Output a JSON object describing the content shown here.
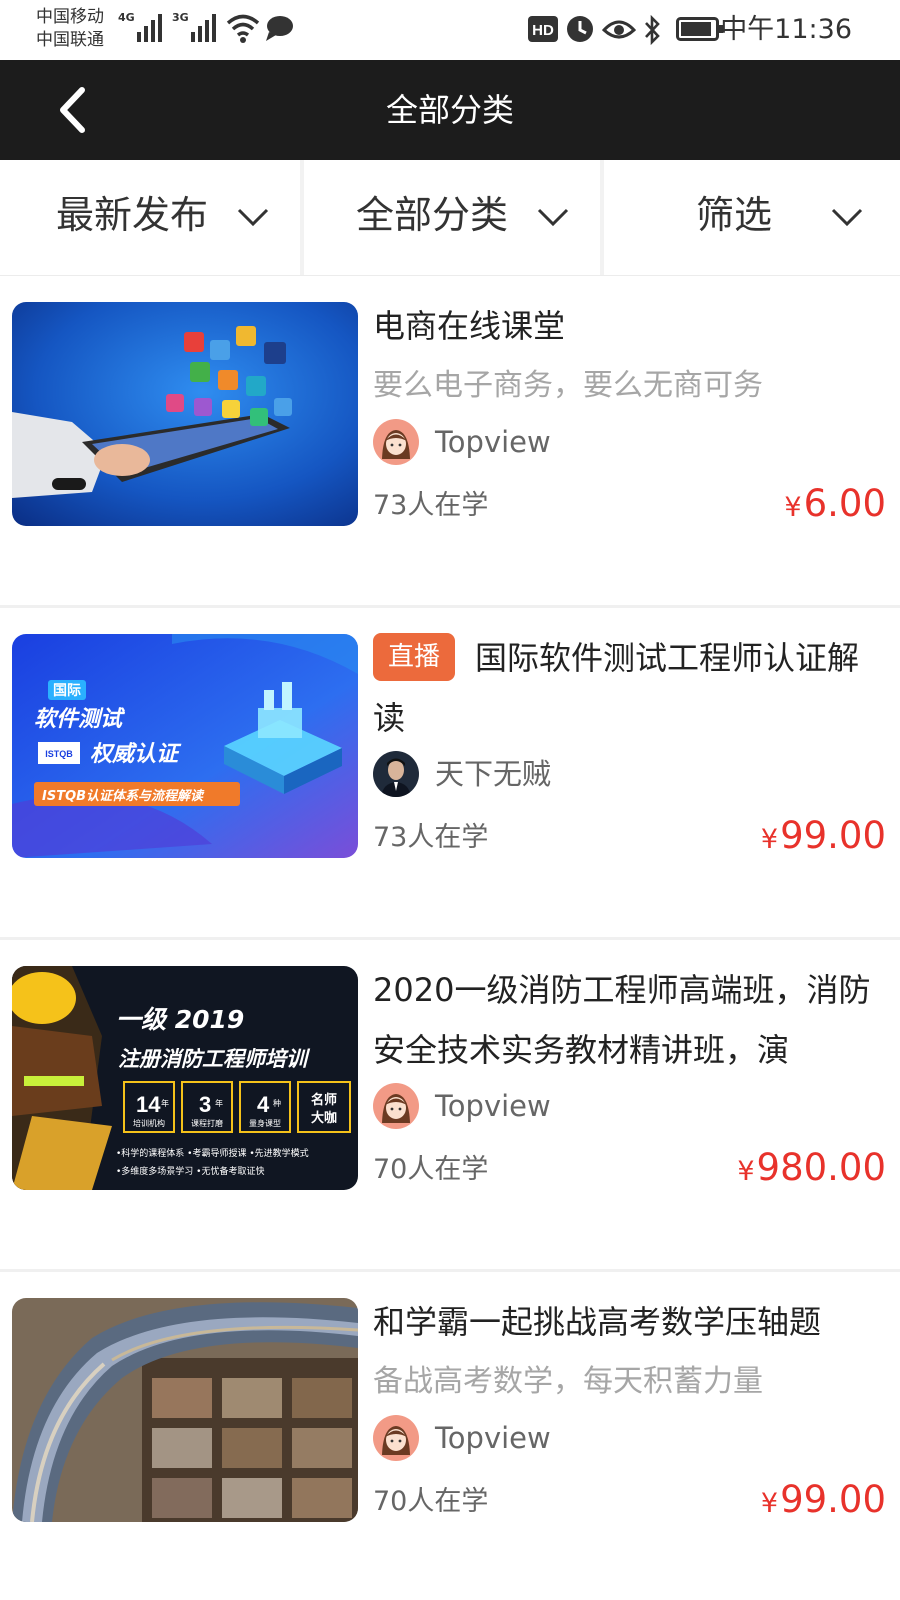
{
  "status_bar": {
    "carrier_1": "中国移动",
    "carrier_2": "中国联通",
    "net_1": "4G",
    "net_2": "3G",
    "time": "中午11:36",
    "icons": [
      "signal-icon",
      "wifi-icon",
      "message-icon",
      "hd-icon",
      "clock-icon",
      "eye-icon",
      "bluetooth-icon",
      "battery-icon"
    ]
  },
  "header": {
    "title": "全部分类",
    "back_icon": "chevron-left-icon"
  },
  "filters": [
    {
      "label": "最新发布"
    },
    {
      "label": "全部分类"
    },
    {
      "label": "筛选"
    }
  ],
  "courses": [
    {
      "title": "电商在线课堂",
      "subtitle": "要么电子商务，要么无商可务",
      "teacher": "Topview",
      "learners": "73人在学",
      "currency": "¥",
      "price": "6.00"
    },
    {
      "badge": "直播",
      "title": "国际软件测试工程师认证解读",
      "teacher": "天下无贼",
      "learners": "73人在学",
      "currency": "¥",
      "price": "99.00",
      "thumb_text": {
        "tag": "国际",
        "line1": "软件测试",
        "logo": "ISTQB",
        "line2": "权威认证",
        "bar": "ISTQB认证体系与流程解读"
      }
    },
    {
      "title": "2020一级消防工程师高端班，消防安全技术实务教材精讲班，演",
      "teacher": "Topview",
      "learners": "70人在学",
      "currency": "¥",
      "price": "980.00",
      "thumb_text": {
        "year": "一级 2019",
        "headline": "注册消防工程师培训",
        "box1_num": "14",
        "box1_unit": "年",
        "box1_label": "培训机构",
        "box2_num": "3",
        "box2_unit": "年",
        "box2_label": "课程打磨",
        "box3_num": "4",
        "box3_unit": "种",
        "box3_label": "量身课型",
        "box4_line1": "名师",
        "box4_line2": "大咖",
        "bullets_1": "•科学的课程体系  •考霸导师授课  •先进教学模式",
        "bullets_2": "•多维度多场景学习  •无忧备考取证快"
      }
    },
    {
      "title": "和学霸一起挑战高考数学压轴题",
      "subtitle": "备战高考数学，每天积蓄力量",
      "teacher": "Topview",
      "learners": "70人在学",
      "currency": "¥",
      "price": "99.00"
    }
  ],
  "colors": {
    "title_bar": "#1c1c1c",
    "price": "#e8322b",
    "live_badge": "#ec6a3c",
    "subtitle": "#a6a6a6"
  }
}
